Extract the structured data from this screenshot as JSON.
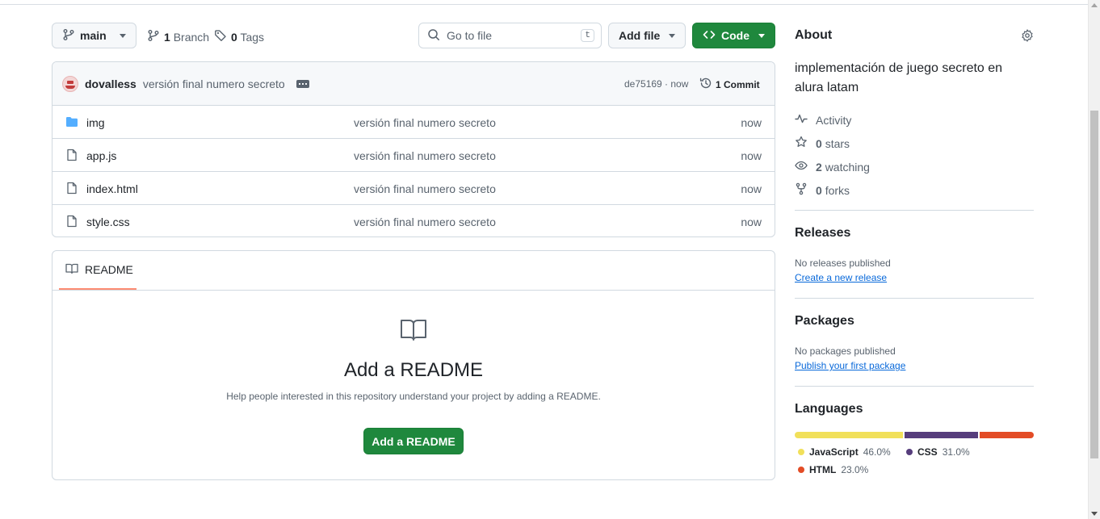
{
  "toolbar": {
    "branch": "main",
    "branches_count": "1",
    "branches_label": "Branch",
    "tags_count": "0",
    "tags_label": "Tags",
    "search_placeholder": "Go to file",
    "search_shortcut": "t",
    "add_file": "Add file",
    "code": "Code"
  },
  "commit": {
    "author": "dovalless",
    "message": "versión final numero secreto",
    "sha_time": "de75169 · now",
    "commits_label": "1 Commit"
  },
  "files": [
    {
      "name": "img",
      "type": "folder",
      "message": "versión final numero secreto",
      "time": "now"
    },
    {
      "name": "app.js",
      "type": "file",
      "message": "versión final numero secreto",
      "time": "now"
    },
    {
      "name": "index.html",
      "type": "file",
      "message": "versión final numero secreto",
      "time": "now"
    },
    {
      "name": "style.css",
      "type": "file",
      "message": "versión final numero secreto",
      "time": "now"
    }
  ],
  "readme": {
    "tab": "README",
    "title": "Add a README",
    "subtitle": "Help people interested in this repository understand your project by adding a README.",
    "button": "Add a README"
  },
  "about": {
    "heading": "About",
    "description": "implementación de juego secreto en alura latam",
    "activity": "Activity",
    "stars_count": "0",
    "stars_label": "stars",
    "watching_count": "2",
    "watching_label": "watching",
    "forks_count": "0",
    "forks_label": "forks"
  },
  "releases": {
    "heading": "Releases",
    "empty": "No releases published",
    "link": "Create a new release"
  },
  "packages": {
    "heading": "Packages",
    "empty": "No packages published",
    "link": "Publish your first package"
  },
  "languages": {
    "heading": "Languages",
    "items": [
      {
        "name": "JavaScript",
        "percent": "46.0%",
        "value": 46.0,
        "color": "#f1e05a"
      },
      {
        "name": "CSS",
        "percent": "31.0%",
        "value": 31.0,
        "color": "#563d7c"
      },
      {
        "name": "HTML",
        "percent": "23.0%",
        "value": 23.0,
        "color": "#e34c26"
      }
    ]
  }
}
